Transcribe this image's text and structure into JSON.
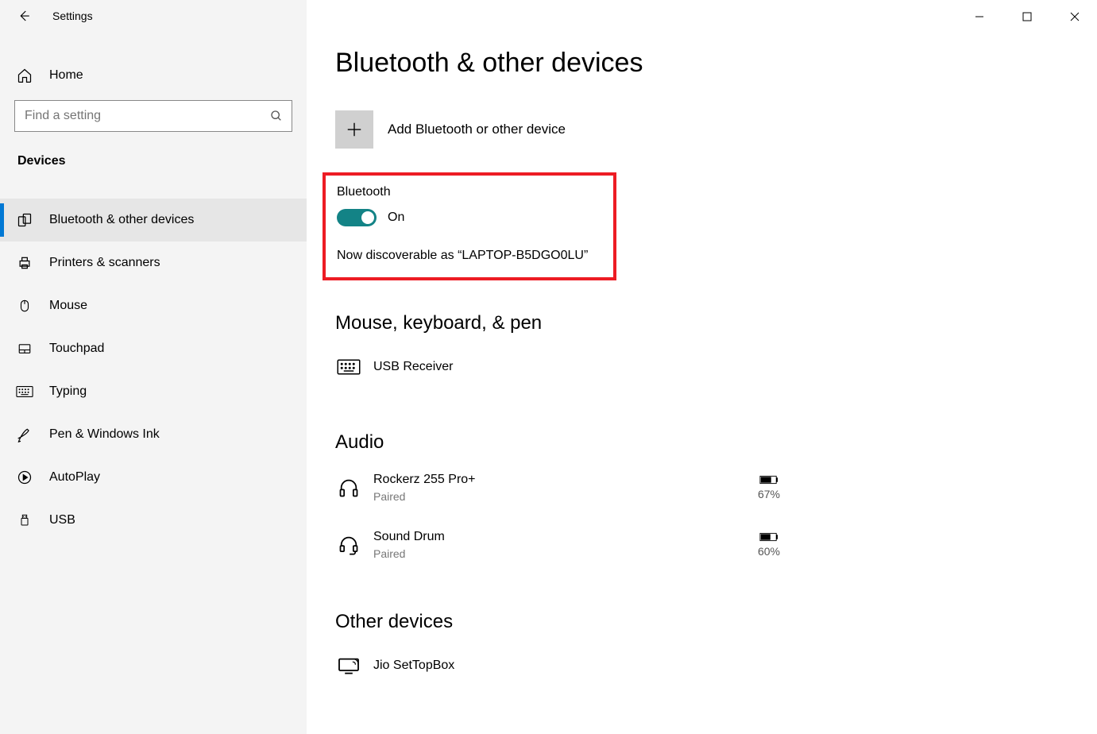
{
  "app_title": "Settings",
  "home_label": "Home",
  "search_placeholder": "Find a setting",
  "sidebar_section": "Devices",
  "nav": [
    {
      "label": "Bluetooth & other devices"
    },
    {
      "label": "Printers & scanners"
    },
    {
      "label": "Mouse"
    },
    {
      "label": "Touchpad"
    },
    {
      "label": "Typing"
    },
    {
      "label": "Pen & Windows Ink"
    },
    {
      "label": "AutoPlay"
    },
    {
      "label": "USB"
    }
  ],
  "page_title": "Bluetooth & other devices",
  "add_device_label": "Add Bluetooth or other device",
  "bluetooth": {
    "label": "Bluetooth",
    "state": "On",
    "discoverable": "Now discoverable as “LAPTOP-B5DGO0LU”"
  },
  "sections": {
    "mouse": "Mouse, keyboard, & pen",
    "audio": "Audio",
    "other": "Other devices"
  },
  "mouse_devices": [
    {
      "name": "USB Receiver"
    }
  ],
  "audio_devices": [
    {
      "name": "Rockerz 255 Pro+",
      "status": "Paired",
      "battery": "67%"
    },
    {
      "name": "Sound Drum",
      "status": "Paired",
      "battery": "60%"
    }
  ],
  "other_devices": [
    {
      "name": "Jio SetTopBox"
    }
  ]
}
